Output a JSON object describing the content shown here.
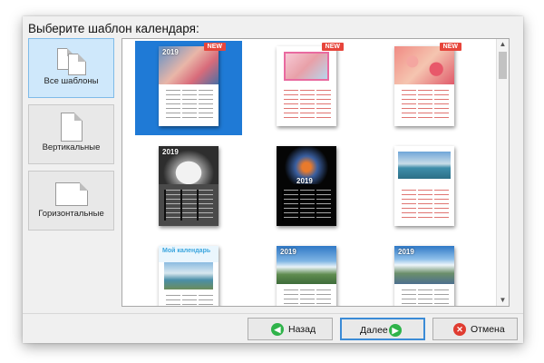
{
  "dialog": {
    "heading": "Выберите шаблон календаря:"
  },
  "categories": [
    {
      "label": "Все шаблоны",
      "icon": "stacked-pages-icon",
      "active": true
    },
    {
      "label": "Вертикальные",
      "icon": "portrait-page-icon",
      "active": false
    },
    {
      "label": "Горизонтальные",
      "icon": "landscape-page-icon",
      "active": false
    }
  ],
  "templates": [
    {
      "badge": "NEW",
      "year": "2019",
      "selected": true
    },
    {
      "badge": "NEW",
      "year": "",
      "selected": false
    },
    {
      "badge": "NEW",
      "year": "",
      "selected": false
    },
    {
      "badge": "",
      "year": "2019",
      "selected": false
    },
    {
      "badge": "",
      "year": "2019",
      "selected": false
    },
    {
      "badge": "",
      "year": "",
      "selected": false
    },
    {
      "badge": "",
      "year": "Мой календарь",
      "selected": false
    },
    {
      "badge": "",
      "year": "2019",
      "selected": false
    },
    {
      "badge": "",
      "year": "2019",
      "selected": false
    }
  ],
  "buttons": {
    "back": "Назад",
    "next": "Далее",
    "cancel": "Отмена"
  },
  "colors": {
    "selection": "#1f7ad6",
    "new_badge": "#e7453b",
    "nav_button_icon": "#2fb34a",
    "cancel_icon": "#e03c31"
  }
}
